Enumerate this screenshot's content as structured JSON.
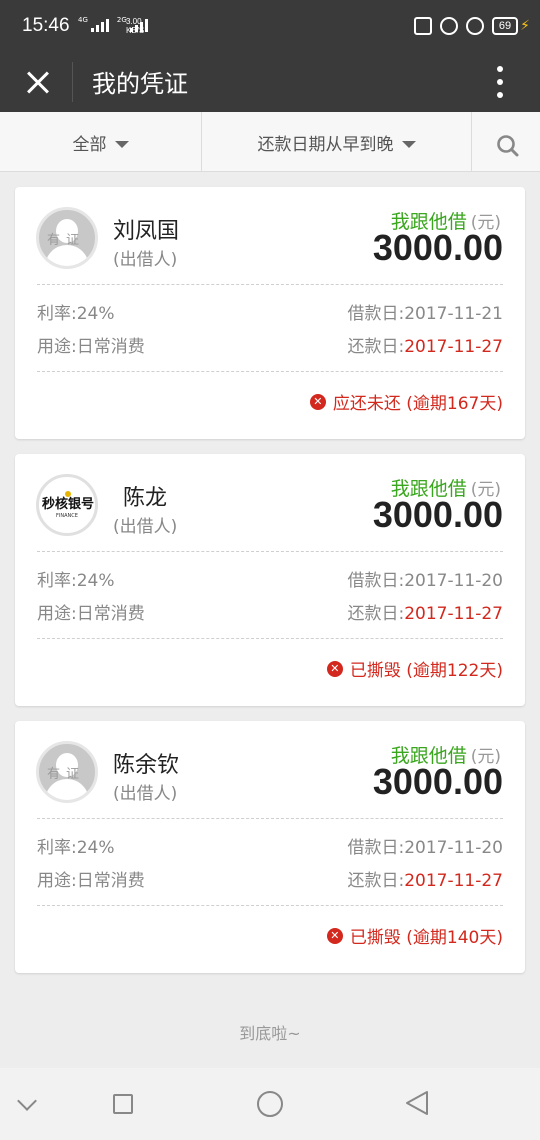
{
  "status_bar": {
    "time": "15:46",
    "net_a": "4G",
    "net_b": "2G",
    "speed_value": "3.00",
    "speed_unit": "KB/S",
    "battery": "69"
  },
  "app_bar": {
    "title": "我的凭证"
  },
  "filters": {
    "category": "全部",
    "sort": "还款日期从早到晚"
  },
  "labels": {
    "role": "(出借人)",
    "direction": "我跟他借",
    "unit": "(元)",
    "rate": "利率:",
    "purpose": "用途:",
    "borrow_date": "借款日:",
    "repay_date": "还款日:"
  },
  "cards": [
    {
      "name": "刘凤国",
      "amount": "3000.00",
      "rate": "24%",
      "purpose": "日常消费",
      "borrow_date": "2017-11-21",
      "repay_date": "2017-11-27",
      "status": "应还未还 (逾期167天)",
      "avatar": "person-placeholder",
      "avatar_watermark": "有证"
    },
    {
      "name": "陈龙",
      "amount": "3000.00",
      "rate": "24%",
      "purpose": "日常消费",
      "borrow_date": "2017-11-20",
      "repay_date": "2017-11-27",
      "status": "已撕毁 (逾期122天)",
      "avatar": "brand-logo",
      "avatar_logo": "秒核银号",
      "avatar_logo_sub": "FINANCE"
    },
    {
      "name": "陈余钦",
      "amount": "3000.00",
      "rate": "24%",
      "purpose": "日常消费",
      "borrow_date": "2017-11-20",
      "repay_date": "2017-11-27",
      "status": "已撕毁 (逾期140天)",
      "avatar": "person-placeholder",
      "avatar_watermark": "有证"
    }
  ],
  "footer": {
    "end_text": "到底啦~"
  },
  "colors": {
    "header_bg": "#3a3a3a",
    "direction_green": "#3aa61e",
    "alert_red": "#d2281d"
  }
}
